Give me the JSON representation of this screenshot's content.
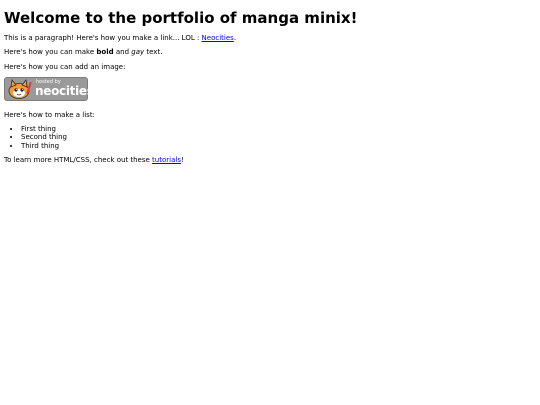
{
  "heading": "Welcome to the portfolio of manga minix!",
  "para1": {
    "text": "This is a paragraph! Here's how you make a link... LOL : ",
    "link": "Neocities",
    "end": "."
  },
  "para2": {
    "start": "Here's how you can make ",
    "bold": "bold",
    "middle": " and ",
    "italic": "gay",
    "end": " text."
  },
  "para3": "Here's how you can add an image:",
  "badge": {
    "hosted": "hosted by",
    "name": "neocities",
    "icon": "neocities-cat-icon"
  },
  "para4": "Here's how to make a list:",
  "list": [
    "First thing",
    "Second thing",
    "Third thing"
  ],
  "para5": {
    "start": "To learn more HTML/CSS, check out these ",
    "link": "tutorials",
    "end": "!"
  }
}
